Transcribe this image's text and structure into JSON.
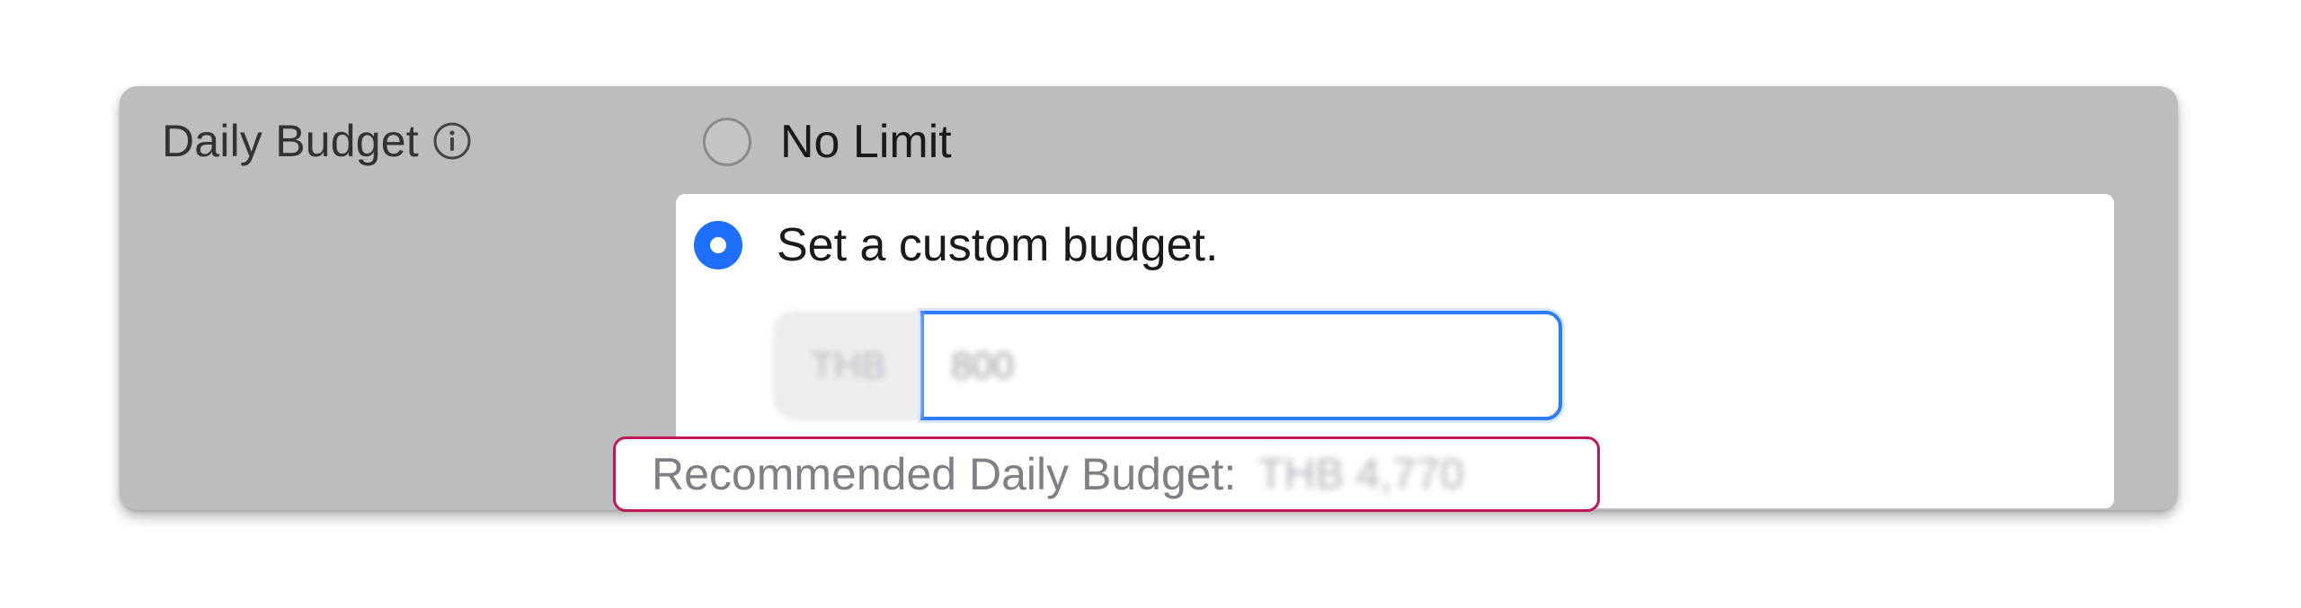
{
  "daily_budget": {
    "label": "Daily Budget",
    "info_icon": "info-circle-icon",
    "options": [
      {
        "label": "No Limit",
        "selected": false
      },
      {
        "label": "Set a custom budget.",
        "selected": true
      }
    ],
    "currency": "THB",
    "amount": "800",
    "recommended_label": "Recommended Daily Budget:",
    "recommended_value": "THB 4,770"
  },
  "colors": {
    "overlay_gray": "#bdbdbd",
    "radio_selected": "#1f6fff",
    "input_focus_border": "#2c7cf6",
    "highlight_border": "#c2185b"
  }
}
